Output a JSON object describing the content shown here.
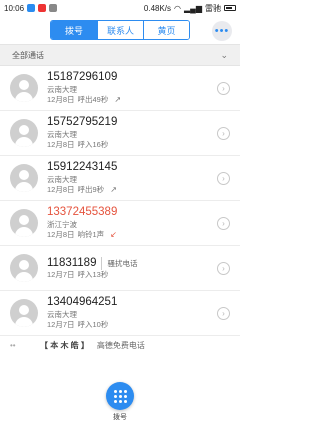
{
  "status_bar": {
    "time": "10:06",
    "speed": "0.48K/s",
    "carrier": "雷驰"
  },
  "tabs": [
    {
      "label": "拨号",
      "active": true
    },
    {
      "label": "联系人",
      "active": false
    },
    {
      "label": "黄页",
      "active": false
    }
  ],
  "more_icon": "more-dots",
  "filter": {
    "label": "全部通话",
    "icon": "chevron-down"
  },
  "calls": [
    {
      "number": "15187296109",
      "tag": "",
      "location": "云南大理",
      "date": "12月8日",
      "status": "呼出49秒",
      "direction": "outgoing",
      "direction_glyph": "↗"
    },
    {
      "number": "15752795219",
      "tag": "",
      "location": "云南大理",
      "date": "12月8日",
      "status": "呼入16秒",
      "direction": "incoming",
      "direction_glyph": ""
    },
    {
      "number": "15912243145",
      "tag": "",
      "location": "云南大理",
      "date": "12月8日",
      "status": "呼出9秒",
      "direction": "outgoing",
      "direction_glyph": "↗"
    },
    {
      "number": "13372455389",
      "tag": "",
      "location": "浙江宁波",
      "date": "12月8日",
      "status": "响铃1声",
      "direction": "missed",
      "direction_glyph": "↙"
    },
    {
      "number": "11831189",
      "tag": "骚扰电话",
      "location": "",
      "date": "12月7日",
      "status": "呼入13秒",
      "direction": "incoming",
      "direction_glyph": ""
    },
    {
      "number": "13404964251",
      "tag": "",
      "location": "云南大理",
      "date": "12月7日",
      "status": "呼入10秒",
      "direction": "incoming",
      "direction_glyph": ""
    }
  ],
  "partial": {
    "name": "【 本 木 皓 】",
    "tag": "高德免费电话"
  },
  "dial_button": {
    "label": "拨号",
    "icon": "dialpad-icon"
  },
  "colors": {
    "accent": "#2d8cf0",
    "missed": "#e5533d"
  }
}
